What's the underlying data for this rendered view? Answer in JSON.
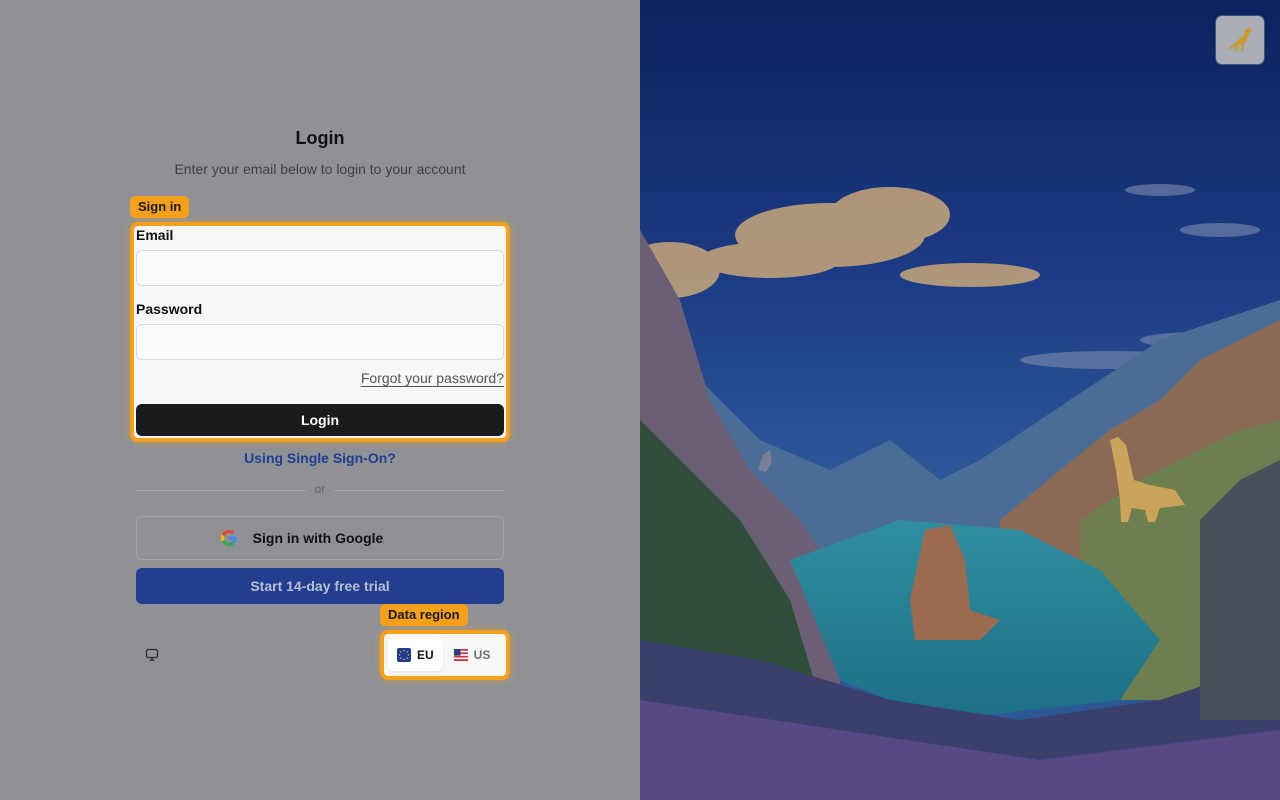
{
  "header": {
    "title": "Login",
    "subtitle": "Enter your email below to login to your account"
  },
  "signin_section": {
    "tag": "Sign in",
    "email_label": "Email",
    "email_value": "",
    "password_label": "Password",
    "password_value": "",
    "forgot_link": "Forgot your password?",
    "login_button": "Login"
  },
  "sso_link": "Using Single Sign-On?",
  "divider_text": "or",
  "google_button": "Sign in with Google",
  "trial_button": "Start 14-day free trial",
  "data_region": {
    "tag": "Data region",
    "options": [
      {
        "label": "EU",
        "selected": true,
        "icon": "eu-flag-icon"
      },
      {
        "label": "US",
        "selected": false,
        "icon": "us-flag-icon"
      }
    ]
  },
  "icons": {
    "theme_toggle": "monitor-icon",
    "logo": "dinosaur-logo-icon",
    "google": "google-icon"
  },
  "colors": {
    "highlight": "#f5a01a",
    "primary_dark": "#1b1b1c",
    "trial_blue": "#243e8f",
    "link_blue": "#1f3e8f"
  }
}
